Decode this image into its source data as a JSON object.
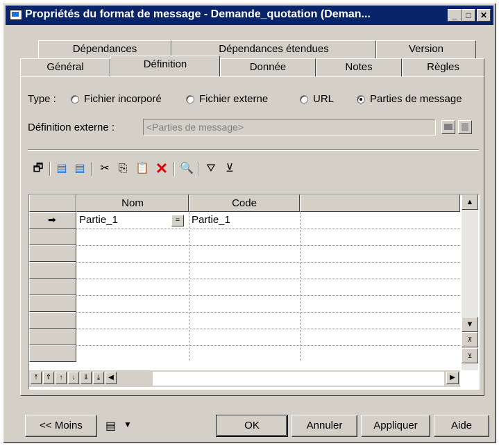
{
  "window": {
    "title": "Propriétés du format de message - Demande_quotation (Deman...",
    "controls": [
      "minimize-icon",
      "maximize-icon",
      "close-icon"
    ]
  },
  "tabs": {
    "row1": [
      "Dépendances",
      "Dépendances étendues",
      "Version"
    ],
    "row2": [
      "Général",
      "Définition",
      "Donnée",
      "Notes",
      "Règles"
    ],
    "active": "Définition"
  },
  "type_group": {
    "label": "Type :",
    "options": [
      {
        "label": "Fichier incorporé",
        "checked": false
      },
      {
        "label": "Fichier externe",
        "checked": false
      },
      {
        "label": "URL",
        "checked": false
      },
      {
        "label": "Parties de message",
        "checked": true
      }
    ]
  },
  "external_definition": {
    "label": "Définition externe :",
    "value": "<Parties de message>"
  },
  "toolbar": {
    "icons": [
      "properties-icon",
      "insert-row-icon",
      "add-row-icon",
      "cut-icon",
      "copy-icon",
      "paste-icon",
      "delete-icon",
      "find-icon",
      "filter-icon",
      "clear-filter-icon"
    ]
  },
  "grid": {
    "columns": [
      "Nom",
      "Code"
    ],
    "rows": [
      {
        "nom": "Partie_1",
        "code": "Partie_1",
        "current": true
      }
    ],
    "empty_rows": 9
  },
  "buttons": {
    "less": "<< Moins",
    "ok": "OK",
    "cancel": "Annuler",
    "apply": "Appliquer",
    "help": "Aide"
  }
}
